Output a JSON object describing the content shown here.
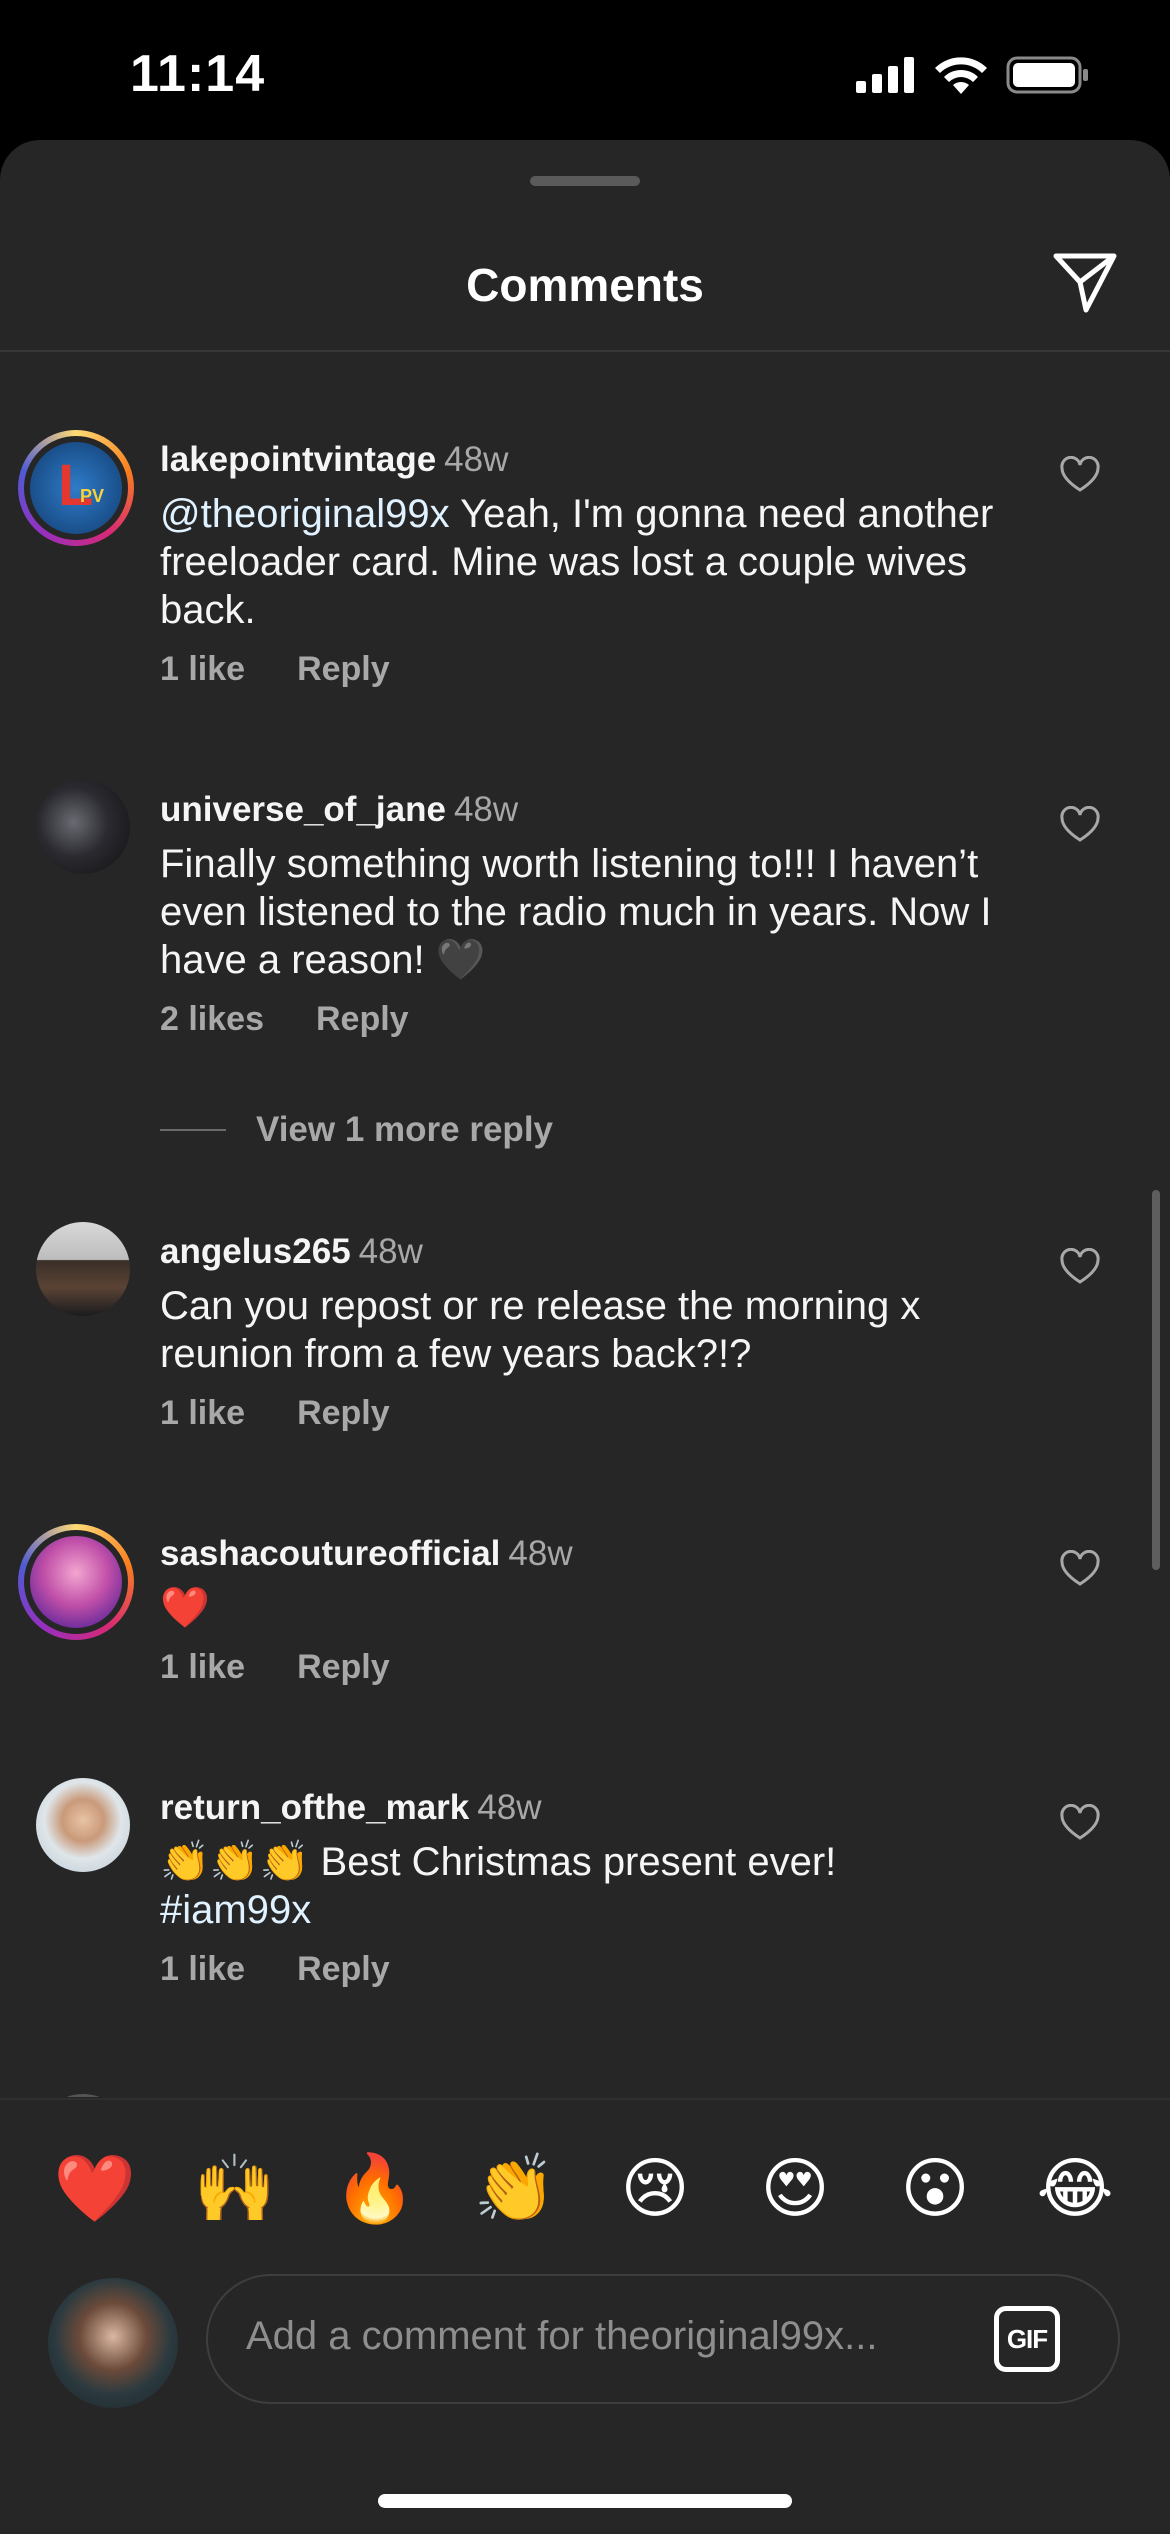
{
  "status_bar": {
    "time": "11:14"
  },
  "header": {
    "title": "Comments"
  },
  "comments": [
    {
      "username": "lakepointvintage",
      "age": "48w",
      "mention": "@theoriginal99x",
      "text": "  Yeah, I'm gonna need another freeloader card. Mine was lost a couple wives back.",
      "likes": "1 like",
      "reply": "Reply"
    },
    {
      "username": "universe_of_jane",
      "age": "48w",
      "text": "Finally something worth listening to!!! I haven’t even listened to the radio much in years. Now I have a reason! 🖤",
      "likes": "2 likes",
      "reply": "Reply",
      "view_more": "View 1 more reply"
    },
    {
      "username": "angelus265",
      "age": "48w",
      "text": "Can you repost or re release the morning x reunion from a few years back?!?",
      "likes": "1 like",
      "reply": "Reply"
    },
    {
      "username": "sashacoutureofficial",
      "age": "48w",
      "text": "❤️",
      "likes": "1 like",
      "reply": "Reply"
    },
    {
      "username": "return_ofthe_mark",
      "age": "48w",
      "text": "👏👏👏 Best Christmas present ever!",
      "hashtag": "#iam99x",
      "likes": "1 like",
      "reply": "Reply"
    }
  ],
  "emoji_bar": [
    "❤️",
    "🙌",
    "🔥",
    "👏",
    "😢",
    "😍",
    "😮",
    "😂"
  ],
  "composer": {
    "placeholder": "Add a comment for theoriginal99x...",
    "gif_label": "GIF"
  },
  "colors": {
    "background": "#262626",
    "text": "#f5f5f5",
    "secondary": "#a8a8a8"
  }
}
